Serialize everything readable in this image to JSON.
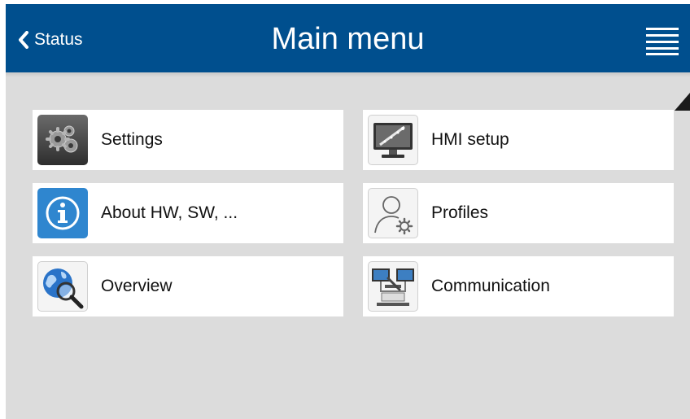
{
  "header": {
    "back_label": "Status",
    "title": "Main menu",
    "bg_color": "#004f8e"
  },
  "icons": {
    "back": "chevron-left-icon",
    "menu": "hamburger-menu-icon"
  },
  "menu": {
    "items": [
      {
        "label": "Settings",
        "icon": "settings-gears-icon"
      },
      {
        "label": "HMI setup",
        "icon": "hmi-monitor-icon"
      },
      {
        "label": "About HW, SW, ...",
        "icon": "info-icon"
      },
      {
        "label": "Profiles",
        "icon": "profile-user-gear-icon"
      },
      {
        "label": "Overview",
        "icon": "globe-magnifier-icon"
      },
      {
        "label": "Communication",
        "icon": "network-computers-icon"
      }
    ]
  }
}
